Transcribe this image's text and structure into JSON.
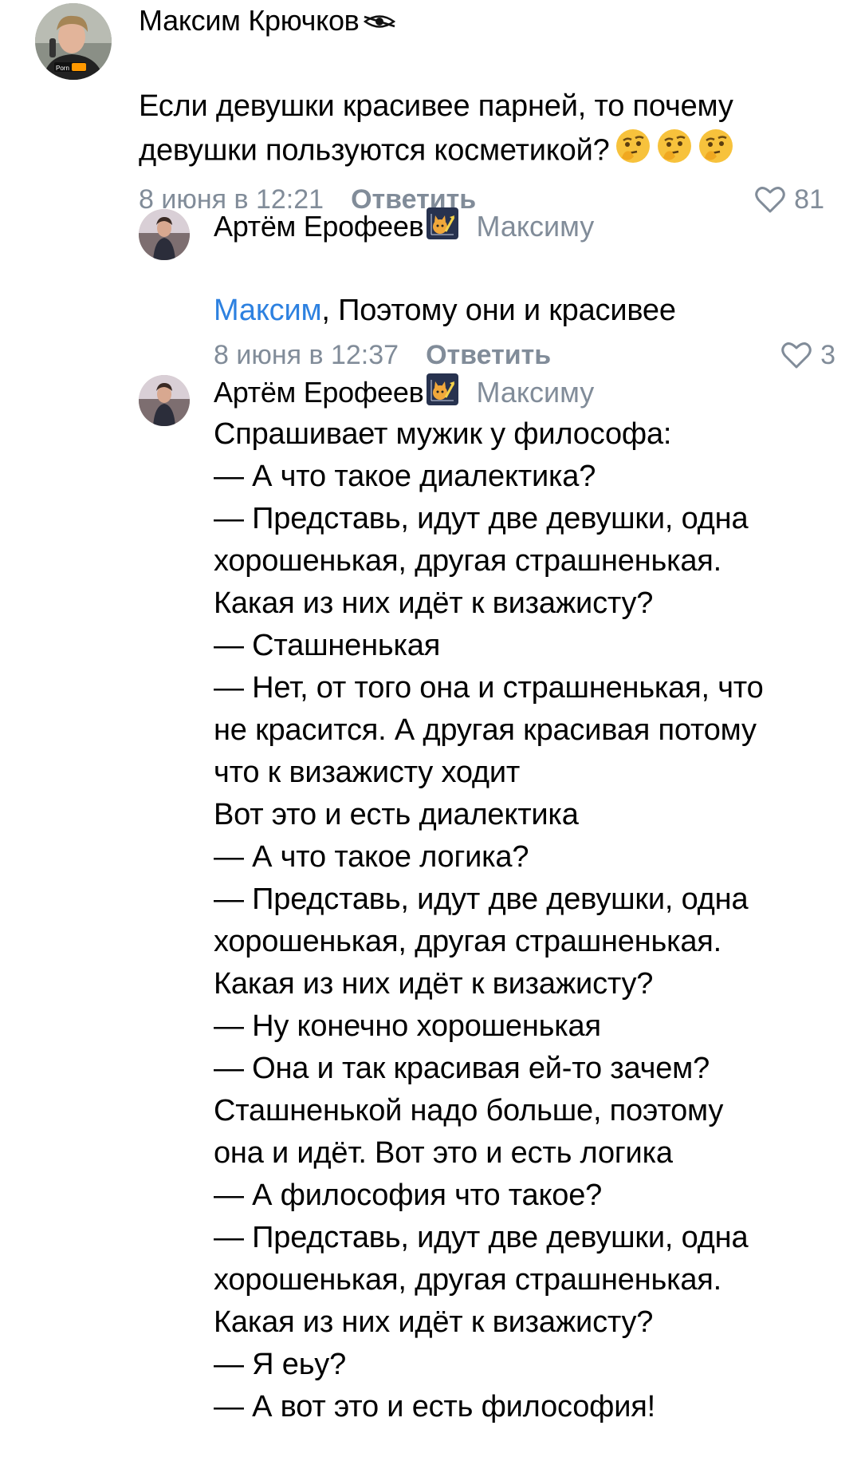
{
  "comments": [
    {
      "author": "Максим Крючков",
      "author_badge_icon": "eye-icon",
      "text": "Если девушки красивее парней, то почему девушки пользуются косметикой?",
      "emojis": [
        "thinking-face",
        "thinking-face",
        "thinking-face"
      ],
      "date": "8 июня в 12:21",
      "reply_label": "Ответить",
      "likes": "81"
    },
    {
      "author": "Артём Ерофеев",
      "author_badge_icon": "cat-graph-icon",
      "reply_to": "Максиму",
      "mention": "Максим",
      "text": ", Поэтому они и красивее",
      "date": "8 июня в 12:37",
      "reply_label": "Ответить",
      "likes": "3"
    },
    {
      "author": "Артём Ерофеев",
      "author_badge_icon": "cat-graph-icon",
      "reply_to": "Максиму",
      "text": "Спрашивает мужик у философа:\n— А что такое диалектика?\n— Представь, идут две девушки, одна\nхорошенькая, другая страшненькая.\nКакая из них идёт к визажисту?\n— Сташненькая\n— Нет, от того она и страшненькая, что\nне красится. А другая красивая потому\nчто к визажисту ходит\nВот это и есть диалектика\n— А что такое логика?\n— Представь, идут две девушки, одна\nхорошенькая, другая страшненькая.\nКакая из них идёт к визажисту?\n— Ну конечно хорошенькая\n— Она и так красивая ей-то зачем?\nСташненькой надо больше, поэтому\nона и идёт. Вот это и есть логика\n— А философия что такое?\n— Представь, идут две девушки, одна\nхорошенькая, другая страшненькая.\nКакая из них идёт к визажисту?\n— Я еьу?\n— А вот это и есть философия!"
    }
  ],
  "colors": {
    "secondary_text": "#818c99",
    "mention": "#2d81e0"
  }
}
